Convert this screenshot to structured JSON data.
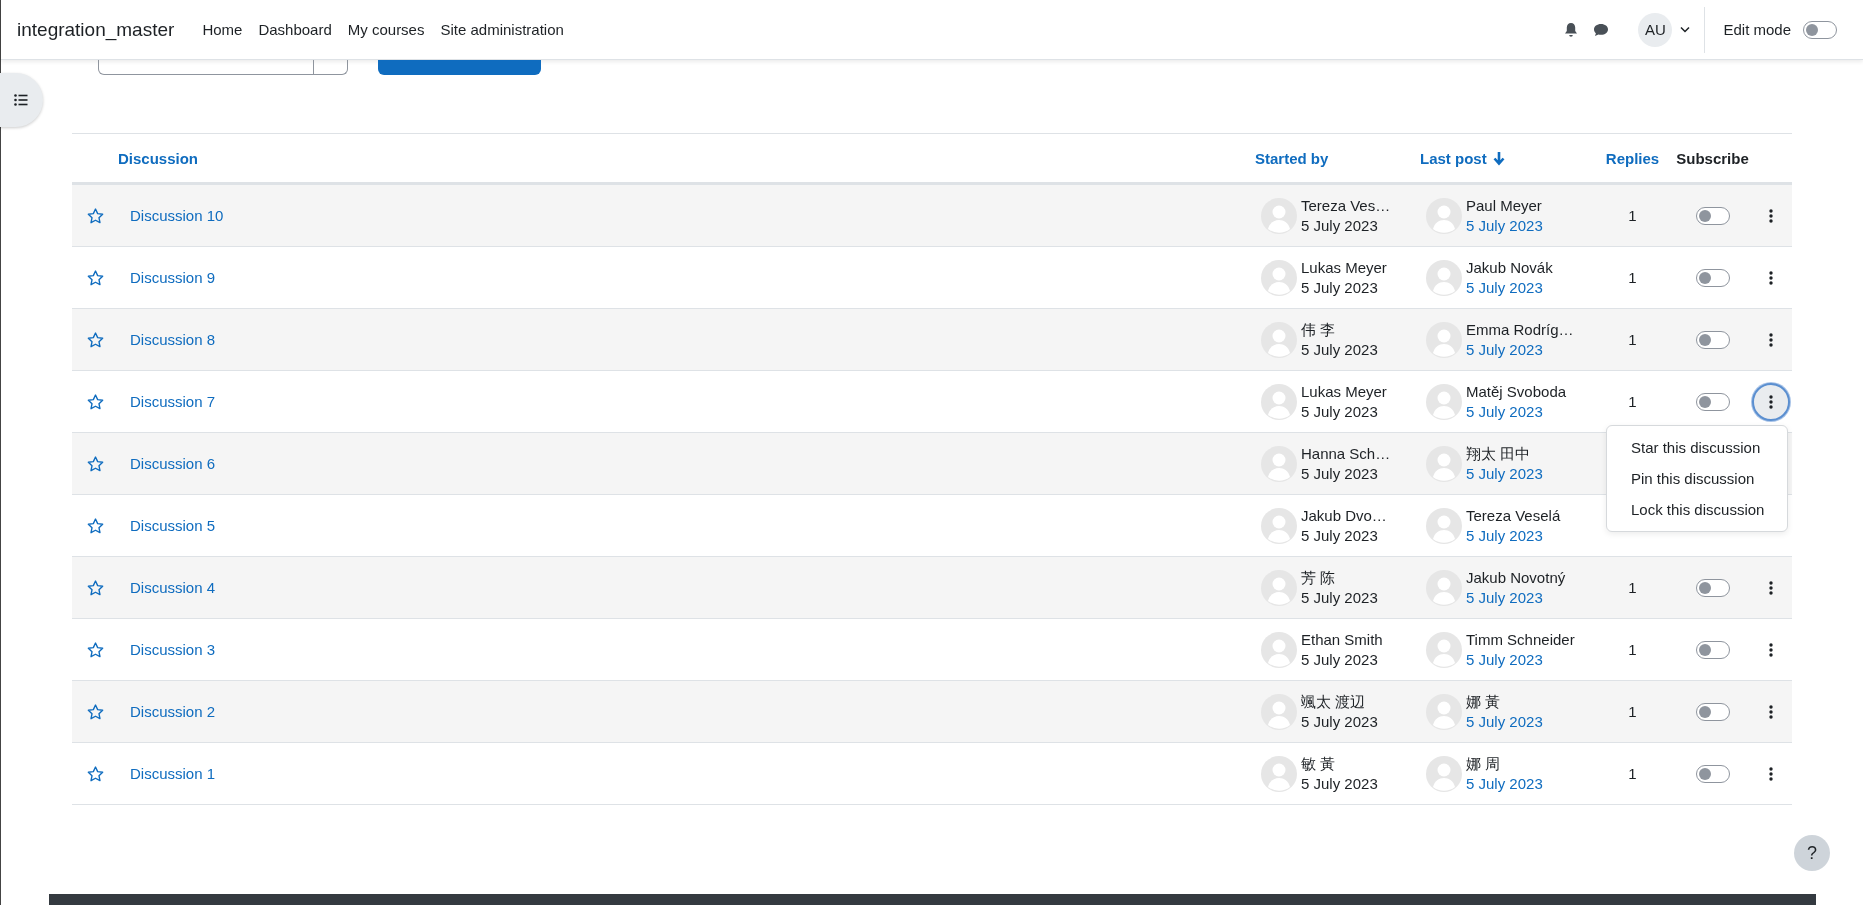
{
  "navbar": {
    "brand": "integration_master",
    "links": [
      "Home",
      "Dashboard",
      "My courses",
      "Site administration"
    ],
    "avatar_initials": "AU",
    "edit_mode": {
      "label": "Edit mode",
      "on": false
    }
  },
  "table": {
    "columns": [
      {
        "label": "Discussion",
        "kind": "link",
        "sorted": false
      },
      {
        "label": "Started by",
        "kind": "link",
        "sorted": false
      },
      {
        "label": "Last post",
        "kind": "link",
        "sorted": true
      },
      {
        "label": "Replies",
        "kind": "link",
        "sorted": false
      },
      {
        "label": "Subscribe",
        "kind": "plain",
        "sorted": false
      }
    ],
    "rows": [
      {
        "title": "Discussion 10",
        "starred": false,
        "started_by": "Tereza Ves…",
        "started": "5 July 2023",
        "last_by": "Paul Meyer",
        "last_date": "5 July 2023",
        "replies": "1",
        "subscribed": false,
        "menu_open": false
      },
      {
        "title": "Discussion 9",
        "starred": false,
        "started_by": "Lukas Meyer",
        "started": "5 July 2023",
        "last_by": "Jakub Novák",
        "last_date": "5 July 2023",
        "replies": "1",
        "subscribed": false,
        "menu_open": false
      },
      {
        "title": "Discussion 8",
        "starred": false,
        "started_by": "伟 李",
        "started": "5 July 2023",
        "last_by": "Emma Rodríg…",
        "last_date": "5 July 2023",
        "replies": "1",
        "subscribed": false,
        "menu_open": false
      },
      {
        "title": "Discussion 7",
        "starred": false,
        "started_by": "Lukas Meyer",
        "started": "5 July 2023",
        "last_by": "Matěj Svoboda",
        "last_date": "5 July 2023",
        "replies": "1",
        "subscribed": false,
        "menu_open": true
      },
      {
        "title": "Discussion 6",
        "starred": false,
        "started_by": "Hanna Sch…",
        "started": "5 July 2023",
        "last_by": "翔太 田中",
        "last_date": "5 July 2023"
      },
      {
        "title": "Discussion 5",
        "starred": false,
        "started_by": "Jakub Dvo…",
        "started": "5 July 2023",
        "last_by": "Tereza Veselá",
        "last_date": "5 July 2023"
      },
      {
        "title": "Discussion 4",
        "starred": false,
        "started_by": "芳 陈",
        "started": "5 July 2023",
        "last_by": "Jakub Novotný",
        "last_date": "5 July 2023",
        "replies": "1",
        "subscribed": false,
        "menu_open": false
      },
      {
        "title": "Discussion 3",
        "starred": false,
        "started_by": "Ethan Smith",
        "started": "5 July 2023",
        "last_by": "Timm Schneider",
        "last_date": "5 July 2023",
        "replies": "1",
        "subscribed": false,
        "menu_open": false
      },
      {
        "title": "Discussion 2",
        "starred": false,
        "started_by": "颯太 渡辺",
        "started": "5 July 2023",
        "last_by": "娜 黃",
        "last_date": "5 July 2023",
        "replies": "1",
        "subscribed": false,
        "menu_open": false
      },
      {
        "title": "Discussion 1",
        "starred": false,
        "started_by": "敏 黃",
        "started": "5 July 2023",
        "last_by": "娜 周",
        "last_date": "5 July 2023",
        "replies": "1",
        "subscribed": false,
        "menu_open": false
      }
    ]
  },
  "action_menu": {
    "items": [
      "Star this discussion",
      "Pin this discussion",
      "Lock this discussion"
    ]
  },
  "help_button": {
    "label": "?"
  }
}
